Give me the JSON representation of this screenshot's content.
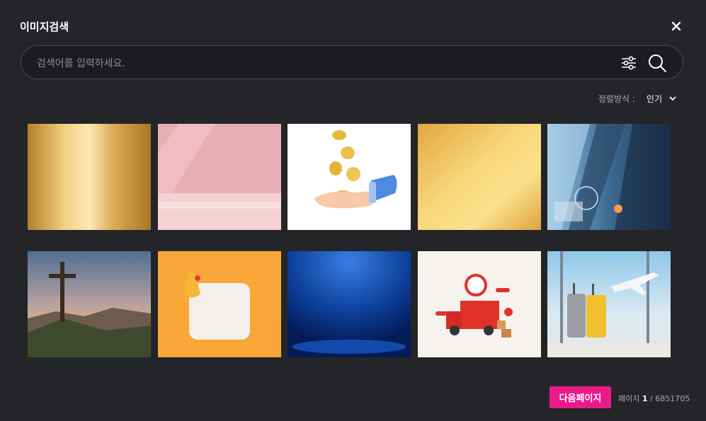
{
  "dialog": {
    "title": "이미지검색",
    "close_icon": "close-icon"
  },
  "search": {
    "placeholder": "검색어를 입력하세요.",
    "value": "",
    "filter_icon": "sliders-icon",
    "search_icon": "search-icon"
  },
  "sort": {
    "label": "정렬방식 :",
    "selected": "인기",
    "chevron_icon": "chevron-down-icon"
  },
  "results": [
    {
      "subject": "gold-foil-texture"
    },
    {
      "subject": "pink-room-corner"
    },
    {
      "subject": "hand-catching-coins"
    },
    {
      "subject": "gold-gradient"
    },
    {
      "subject": "business-technology-collage"
    },
    {
      "subject": "cross-on-hill-sunset"
    },
    {
      "subject": "notification-bell-card"
    },
    {
      "subject": "blue-spotlight-backdrop"
    },
    {
      "subject": "delivery-truck"
    },
    {
      "subject": "luggage-airport-airplane"
    }
  ],
  "pagination": {
    "next_label": "다음페이지",
    "page_prefix": "페이지",
    "current_page": "1",
    "separator": "/",
    "total": "6851705"
  },
  "colors": {
    "background": "#242528",
    "search_bg": "#1b1c1f",
    "accent": "#ea1a8b"
  }
}
